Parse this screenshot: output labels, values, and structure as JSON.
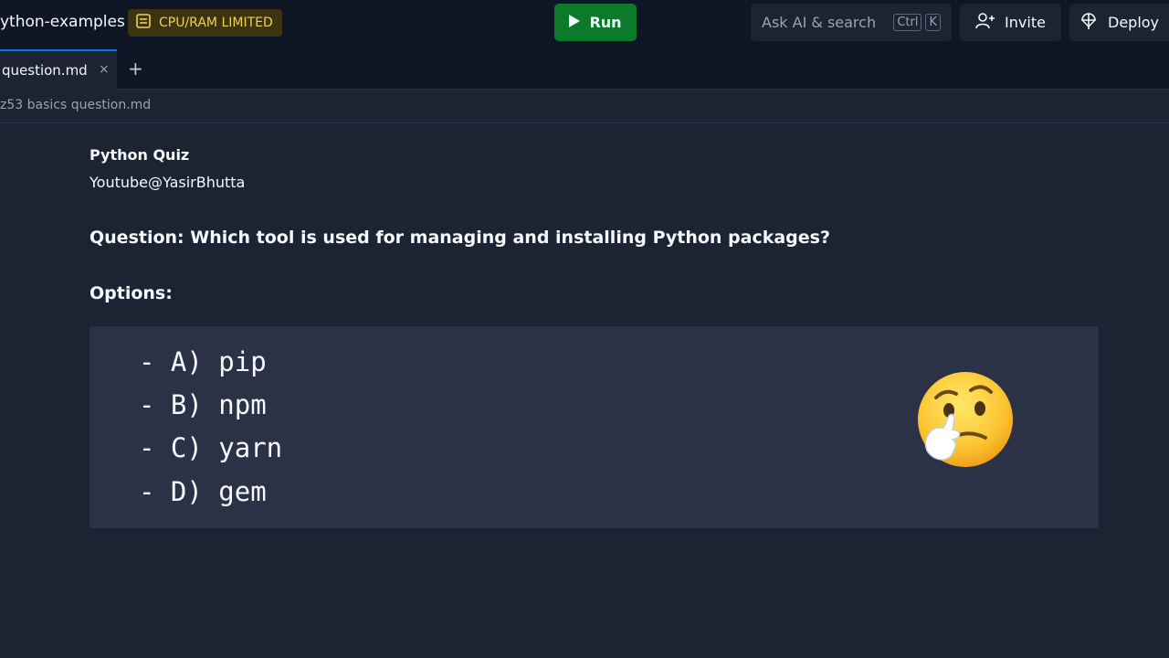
{
  "header": {
    "project_name": "ython-examples",
    "limit_badge": "CPU/RAM LIMITED",
    "run_label": "Run",
    "search_label": "Ask AI & search",
    "search_kbd": [
      "Ctrl",
      "K"
    ],
    "invite_label": "Invite",
    "deploy_label": "Deploy"
  },
  "tabs": [
    {
      "label": "question.md",
      "close": "×"
    }
  ],
  "add_tab": "+",
  "breadcrumb": "z53 basics question.md",
  "document": {
    "title": "Python Quiz",
    "author": "Youtube@YasirBhutta",
    "question": "Question: Which tool is used for managing and installing Python packages?",
    "options_heading": "Options:",
    "options": [
      "- A) pip",
      "- B) npm",
      "- C) yarn",
      "- D) gem"
    ]
  },
  "colors": {
    "background": "#1c2333",
    "topbar": "#0e1525",
    "run_button": "#0b7a2a",
    "badge_text": "#f0cf55",
    "tab_accent": "#0079f2"
  },
  "icons": {
    "badge": "cpu-icon",
    "run": "play-icon",
    "invite": "add-user-icon",
    "deploy": "deploy-icon",
    "emoji": "thinking-face-icon"
  }
}
